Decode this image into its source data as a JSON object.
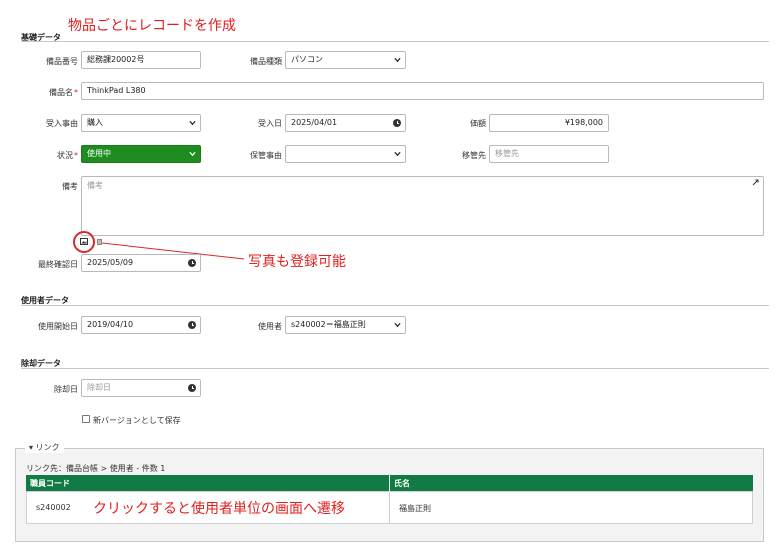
{
  "annotations": {
    "top": "物品ごとにレコードを作成",
    "photo": "写真も登録可能",
    "click": "クリックすると使用者単位の画面へ遷移"
  },
  "basic": {
    "title": "基礎データ",
    "item_no_label": "備品番号",
    "item_no_value": "総務課20002号",
    "item_type_label": "備品種類",
    "item_type_value": "パソコン",
    "item_name_label": "備品名",
    "item_name_value": "ThinkPad L380",
    "received_reason_label": "受入事由",
    "received_reason_value": "購入",
    "received_date_label": "受入日",
    "received_date_value": "2025/04/01",
    "price_label": "価額",
    "price_value": "¥198,000",
    "status_label": "状況",
    "status_value": "使用中",
    "custody_reason_label": "保管事由",
    "custody_reason_value": "",
    "transfer_label": "移管先",
    "transfer_placeholder": "移管先",
    "remarks_label": "備考",
    "remarks_placeholder": "備考",
    "last_check_label": "最終確認日",
    "last_check_value": "2025/05/09",
    "required_mark": "*"
  },
  "user": {
    "title": "使用者データ",
    "start_label": "使用開始日",
    "start_value": "2019/04/10",
    "user_label": "使用者",
    "user_value": "s240002＝福島正則"
  },
  "disposal": {
    "title": "除却データ",
    "date_label": "除却日",
    "date_placeholder": "除却日",
    "new_version_label": "新バージョンとして保存"
  },
  "link": {
    "legend": "▾ リンク",
    "path": "リンク先：備品台帳 > 使用者 - 件数 1",
    "headers": [
      "職員コード",
      "氏名"
    ],
    "rows": [
      [
        "s240002",
        "福島正則"
      ]
    ]
  },
  "colors": {
    "accent_green": "#127a45",
    "status_green": "#1e8c1e",
    "annotation_red": "#e0201f"
  }
}
